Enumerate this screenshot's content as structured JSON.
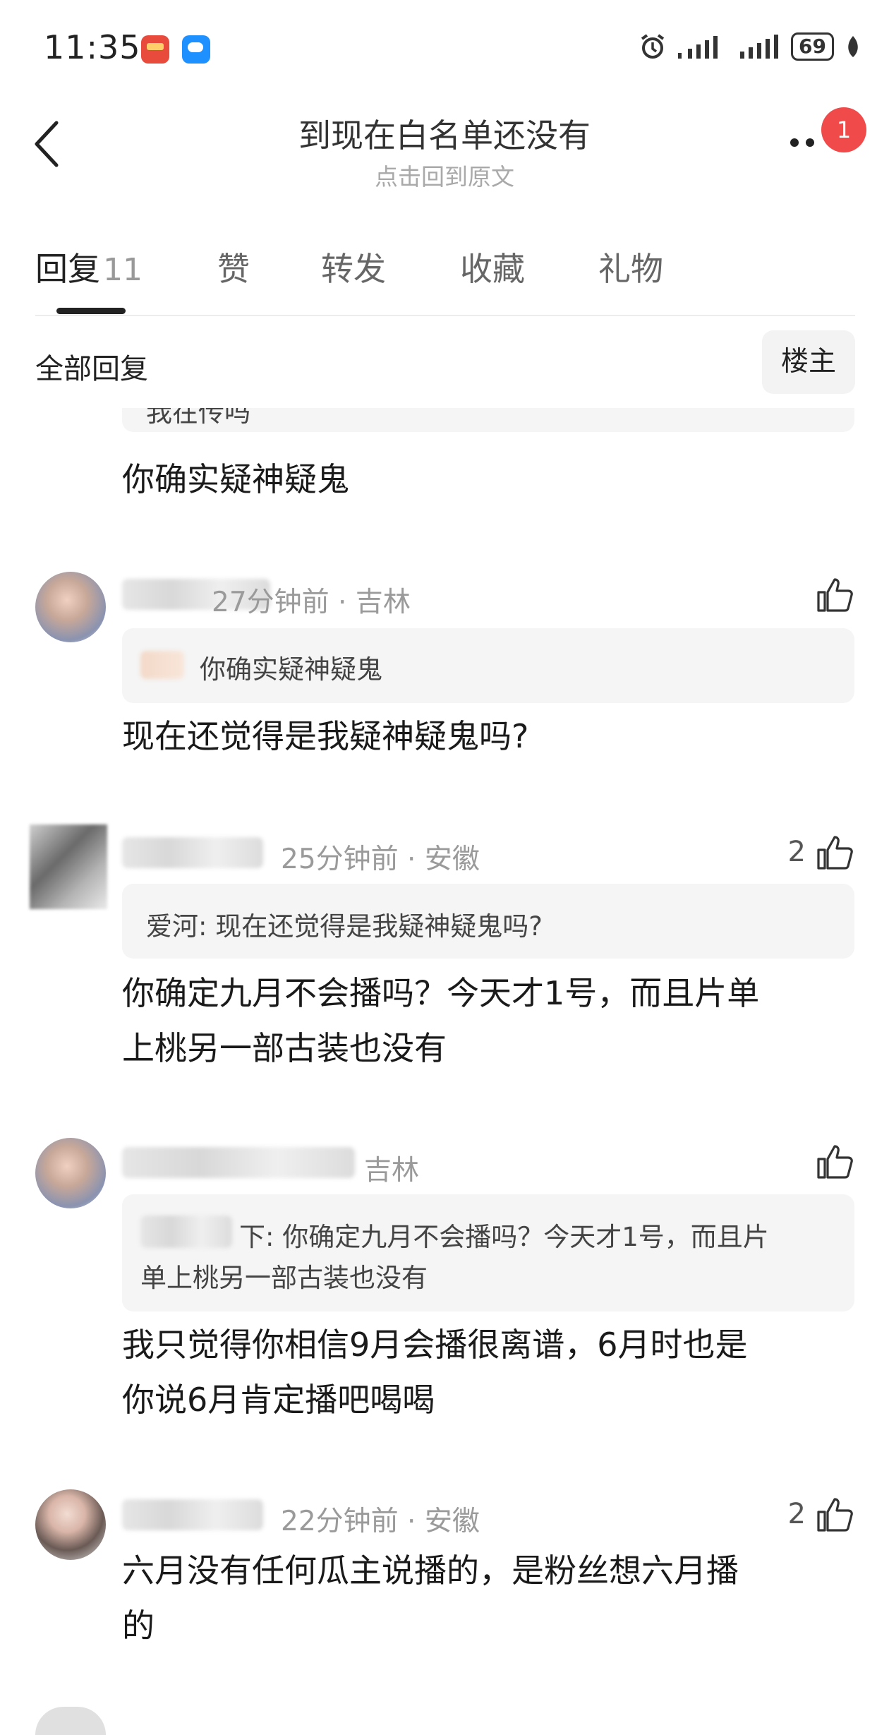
{
  "status_bar": {
    "time": "11:35",
    "battery": "69",
    "icons": [
      "alarm-icon",
      "signal-icon",
      "signal-icon",
      "battery-icon",
      "leaf-icon"
    ]
  },
  "header": {
    "title": "到现在白名单还没有",
    "subtitle": "点击回到原文",
    "badge": "1"
  },
  "tabs": [
    {
      "label": "回复",
      "count": "11"
    },
    {
      "label": "赞"
    },
    {
      "label": "转发"
    },
    {
      "label": "收藏"
    },
    {
      "label": "礼物"
    }
  ],
  "filter": {
    "label": "全部回复",
    "owner_button": "楼主"
  },
  "comments": [
    {
      "quote_partial": "我在传吗",
      "body": "你确实疑神疑鬼"
    },
    {
      "name": "爱河",
      "time": "27分钟前",
      "location": "吉林",
      "quote": "你确实疑神疑鬼",
      "body": "现在还觉得是我疑神疑鬼吗?",
      "likes": ""
    },
    {
      "time": "25分钟前",
      "location": "安徽",
      "likes": "2",
      "quote": "爱河: 现在还觉得是我疑神疑鬼吗?",
      "body_lines": [
        "你确定九月不会播吗？今天才1号，而且片单",
        "上桃另一部古装也没有"
      ]
    },
    {
      "location": "吉林",
      "likes": "",
      "quote_lines": [
        "下: 你确定九月不会播吗？今天才1号，而且片",
        "单上桃另一部古装也没有"
      ],
      "body_lines": [
        "我只觉得你相信9月会播很离谱，6月时也是",
        "你说6月肯定播吧喝喝"
      ]
    },
    {
      "time": "22分钟前",
      "location": "安徽",
      "likes": "2",
      "body_lines": [
        "六月没有任何瓜主说播的，是粉丝想六月播",
        "的"
      ]
    }
  ],
  "colors": {
    "badge": "#f04a4a",
    "meta": "#9a9a9a",
    "quote_bg": "#f5f5f5"
  }
}
